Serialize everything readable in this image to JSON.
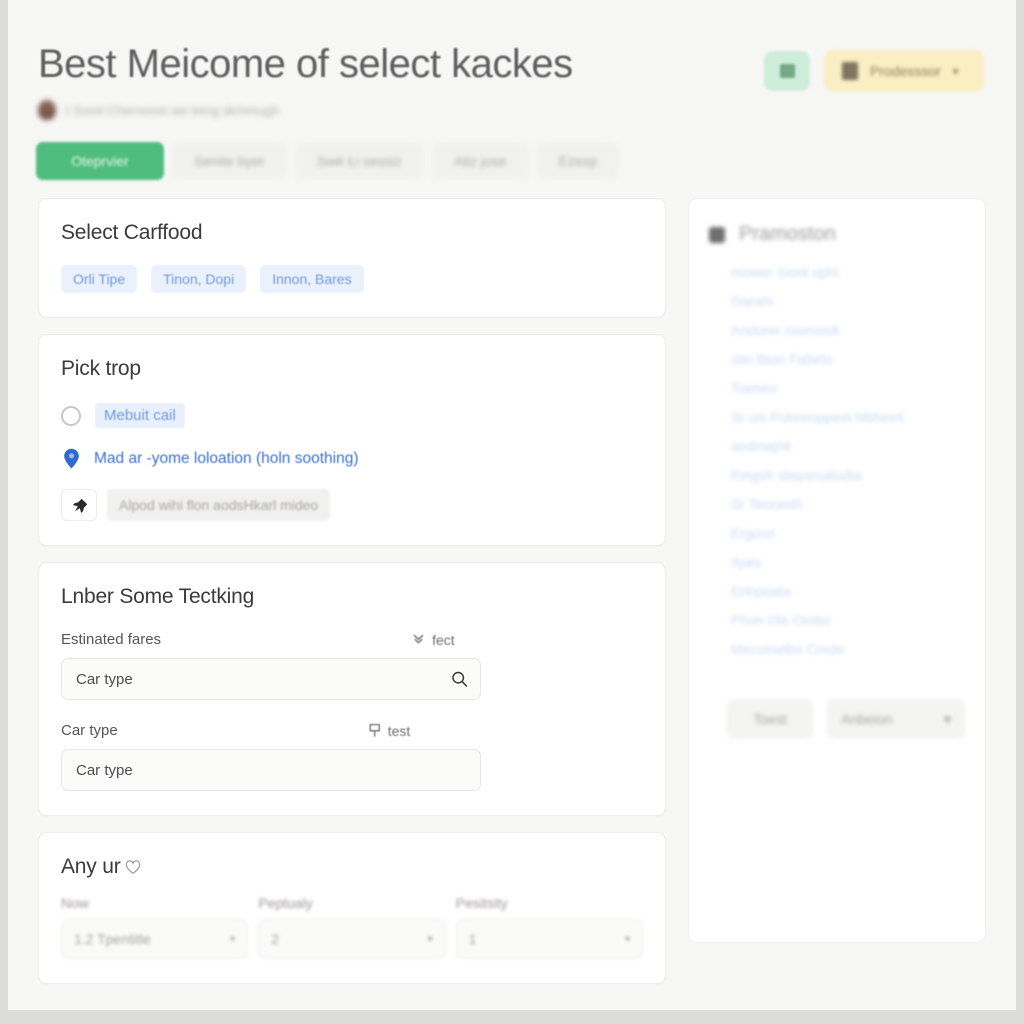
{
  "header": {
    "title": "Best Meicome of select kackes",
    "subtitle": "t Sorel  Chernonst  we teing dichmugh",
    "icon_button": "grid-icon",
    "badge": {
      "label": "Prodesssor",
      "caret": "▾",
      "icon": "badge-icon"
    }
  },
  "tabs": [
    {
      "label": "Oteprvier",
      "active": true
    },
    {
      "label": "Senite byer",
      "active": false
    },
    {
      "label": "Swé Łi sessiz",
      "active": false
    },
    {
      "label": "Atiz jose",
      "active": false
    },
    {
      "label": "Ezexp",
      "active": false
    }
  ],
  "cards": {
    "select_carffood": {
      "title": "Select Carffood",
      "chips": [
        "Orli Tipe",
        "Tinon, Dopi",
        "Innon, Bares"
      ]
    },
    "pick_trop": {
      "title": "Pick trop",
      "radio_label": "Mebuit cail",
      "location_text": "Mad ar -yome loloation (holn soothing)",
      "action_text": "Alpod wihi flon aodsHkarl mideo"
    },
    "tectking": {
      "title": "Lnber Some Tectking",
      "field1": {
        "label": "Estinated fares",
        "hint": "fect",
        "hint_icon": "download-icon",
        "placeholder": "Car type",
        "icon": "search-icon"
      },
      "field2": {
        "label": "Car type",
        "hint": "test",
        "hint_icon": "flag-icon",
        "placeholder": "Car type"
      }
    },
    "any_ur": {
      "title": "Any ur",
      "title_icon": "heart-icon",
      "columns": [
        {
          "label": "Now",
          "value": "1.2 Tpentitle",
          "caret": "▾"
        },
        {
          "label": "Peptualy",
          "value": "2",
          "caret": "▾"
        },
        {
          "label": "Pesitsity",
          "value": "1",
          "caret": "▾"
        }
      ]
    }
  },
  "sidebar": {
    "heading": "Pramoston",
    "heading_icon": "list-icon",
    "links": [
      "mower Sionł uphl",
      "Garahi",
      "Andorer  rasinoisk",
      "stei  Bton Fabeto",
      "Tiameo",
      "Sr uis  Potesioppest  Nbheint",
      "aedmajhli",
      "Eingsh  stepsroatodia",
      "Sr  Teoranth",
      "Ergosn",
      "Ajais",
      "Enhpoata",
      "Phon  Ols   Orobs",
      "Mecomelbs   Crede"
    ],
    "bottom": {
      "button": "Toest",
      "select_value": "Anbeion",
      "caret": "▾"
    }
  },
  "colors": {
    "accent_green": "#4fbd7e",
    "chip_blue": "#6f9ade",
    "link_blue": "#3b6fd0",
    "badge_amber": "#faeec3",
    "page_bg": "#f7f7f5"
  }
}
